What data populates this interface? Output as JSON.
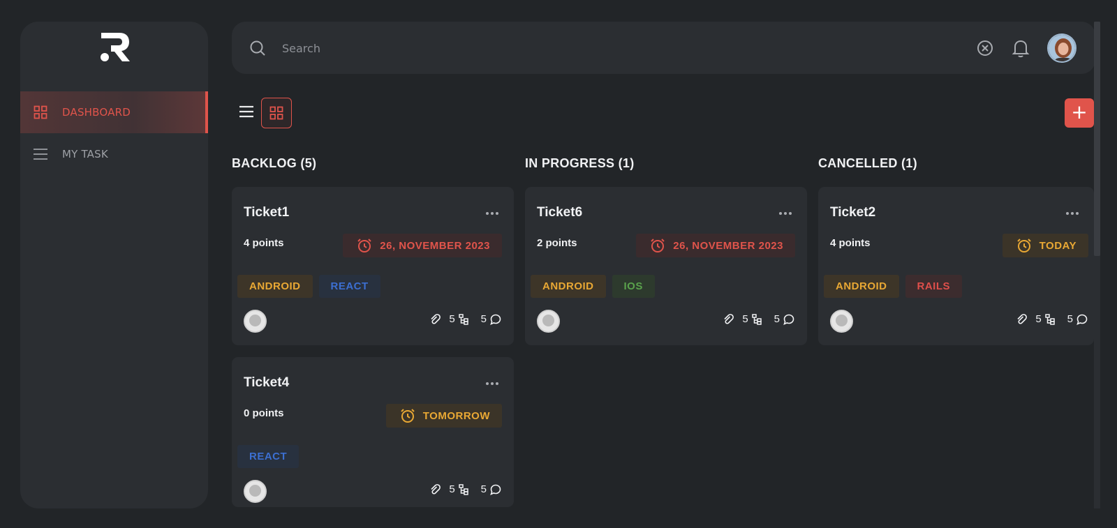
{
  "sidebar": {
    "logo": "R",
    "items": [
      {
        "label": "DASHBOARD",
        "icon": "grid-icon",
        "active": true
      },
      {
        "label": "MY TASK",
        "icon": "menu-icon",
        "active": false
      }
    ]
  },
  "search": {
    "placeholder": "Search",
    "value": ""
  },
  "colors": {
    "accent": "#e0544b",
    "amber": "#e9a834",
    "blue": "#3c6fd1",
    "green": "#5aa24c",
    "bg": "#222528",
    "panel": "#2b2e32"
  },
  "toolbar": {
    "add_label": "+"
  },
  "columns": [
    {
      "title": "BACKLOG (5)",
      "cards": [
        {
          "title": "Ticket1",
          "points": "4 points",
          "due": "26, NOVEMBER 2023",
          "tags": [
            "ANDROID",
            "REACT"
          ],
          "attachments": "5",
          "subtasks": "5",
          "comments": ""
        },
        {
          "title": "Ticket4",
          "points": "0 points",
          "due": "TOMORROW",
          "tags": [
            "REACT"
          ],
          "attachments": "5",
          "subtasks": "5",
          "comments": ""
        }
      ]
    },
    {
      "title": "IN PROGRESS (1)",
      "cards": [
        {
          "title": "Ticket6",
          "points": "2 points",
          "due": "26, NOVEMBER 2023",
          "tags": [
            "ANDROID",
            "IOS"
          ],
          "attachments": "5",
          "subtasks": "5",
          "comments": ""
        }
      ]
    },
    {
      "title": "CANCELLED (1)",
      "cards": [
        {
          "title": "Ticket2",
          "points": "4 points",
          "due": "TODAY",
          "tags": [
            "ANDROID",
            "RAILS"
          ],
          "attachments": "5",
          "subtasks": "5",
          "comments": ""
        }
      ]
    }
  ]
}
